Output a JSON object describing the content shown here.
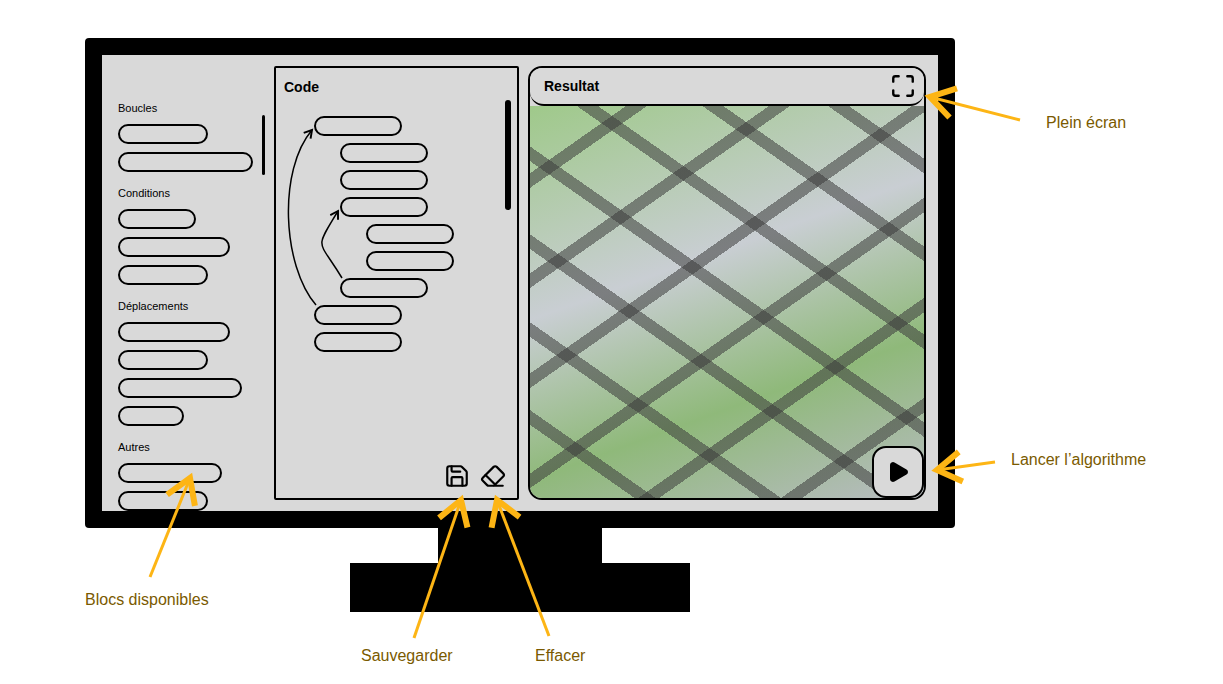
{
  "sidebar": {
    "groups": [
      {
        "title": "Boucles",
        "blocks": 2
      },
      {
        "title": "Conditions",
        "blocks": 3
      },
      {
        "title": "Déplacements",
        "blocks": 4
      },
      {
        "title": "Autres",
        "blocks": 2
      }
    ]
  },
  "code": {
    "title": "Code",
    "blocks": [
      {
        "indent": 0
      },
      {
        "indent": 1
      },
      {
        "indent": 1
      },
      {
        "indent": 1
      },
      {
        "indent": 2
      },
      {
        "indent": 2
      },
      {
        "indent": 1
      },
      {
        "indent": 0
      },
      {
        "indent": 0
      }
    ],
    "loops": [
      {
        "from": 7,
        "to": 0
      },
      {
        "from": 6,
        "to": 3
      }
    ]
  },
  "result": {
    "title": "Resultat"
  },
  "annotations": [
    {
      "label": "Plein écran"
    },
    {
      "label": "Lancer l’algorithme"
    },
    {
      "label": "Blocs disponibles"
    },
    {
      "label": "Sauvegarder"
    },
    {
      "label": "Effacer"
    }
  ]
}
